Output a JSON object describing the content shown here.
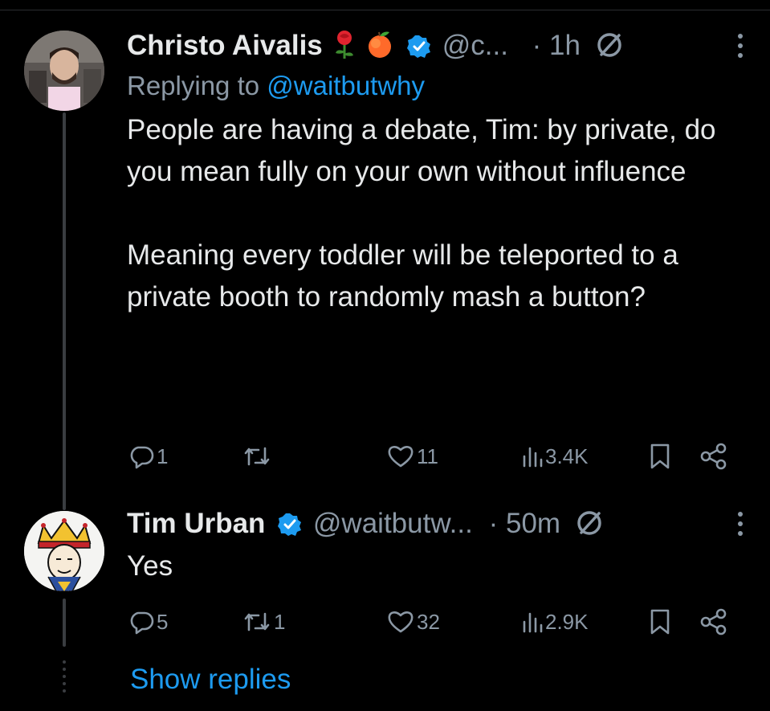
{
  "tweets": [
    {
      "name": "Christo Aivalis",
      "emojis": [
        "rose",
        "peach"
      ],
      "verified": true,
      "handle": "@c...",
      "separator": "·",
      "time": "1h",
      "replying_prefix": "Replying to",
      "replying_to": "@waitbutwhy",
      "text": "People are having a debate, Tim: by private, do you mean fully on your own without influence\n\nMeaning every toddler will be teleported to a private booth to randomly mash a button?",
      "replies": "1",
      "reposts": "",
      "likes": "11",
      "views": "3.4K"
    },
    {
      "name": "Tim Urban",
      "verified": true,
      "handle": "@waitbutw...",
      "separator": "·",
      "time": "50m",
      "text": "Yes",
      "replies": "5",
      "reposts": "1",
      "likes": "32",
      "views": "2.9K"
    }
  ],
  "show_replies": "Show replies",
  "colors": {
    "accent": "#1d9bf0",
    "muted": "#8b98a5",
    "text": "#e7e9ea",
    "background": "#000000"
  },
  "icons": [
    "reply-icon",
    "repost-icon",
    "like-icon",
    "views-icon",
    "bookmark-icon",
    "share-icon",
    "verified-badge-icon",
    "edit-icon",
    "more-icon"
  ]
}
